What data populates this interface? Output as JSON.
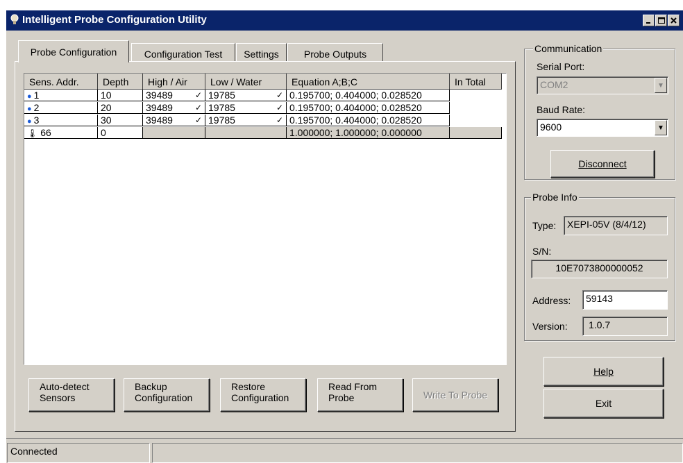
{
  "window": {
    "title": "Intelligent Probe Configuration Utility",
    "controls": [
      "minimize-icon",
      "maximize-icon",
      "close-icon"
    ]
  },
  "tabs": [
    {
      "label": "Probe Configuration",
      "active": true
    },
    {
      "label": "Configuration Test",
      "active": false
    },
    {
      "label": "Settings",
      "active": false
    },
    {
      "label": "Probe Outputs",
      "active": false
    }
  ],
  "grid": {
    "columns": [
      "Sens. Addr.",
      "Depth",
      "High / Air",
      "Low / Water",
      "Equation  A;B;C",
      "In Total"
    ],
    "rows": [
      {
        "icon": "water-drop-icon",
        "addr": "1",
        "depth": "10",
        "high": "39489",
        "low": "19785",
        "equation": "0.195700; 0.404000; 0.028520",
        "total": ""
      },
      {
        "icon": "water-drop-icon",
        "addr": "2",
        "depth": "20",
        "high": "39489",
        "low": "19785",
        "equation": "0.195700; 0.404000; 0.028520",
        "total": ""
      },
      {
        "icon": "water-drop-icon",
        "addr": "3",
        "depth": "30",
        "high": "39489",
        "low": "19785",
        "equation": "0.195700; 0.404000; 0.028520",
        "total": ""
      },
      {
        "icon": "thermometer-icon",
        "addr": "66",
        "depth": "0",
        "high": "",
        "low": "",
        "equation": "1.000000; 1.000000; 0.000000",
        "total": ""
      }
    ]
  },
  "actions": {
    "auto_detect": "Auto-detect\nSensors",
    "backup": "Backup\nConfiguration",
    "restore": "Restore\nConfiguration",
    "read": "Read From\nProbe",
    "write": "Write To Probe"
  },
  "communication": {
    "group_label": "Communication",
    "serial_port_label": "Serial Port:",
    "serial_port_value": "COM2",
    "baud_rate_label": "Baud Rate:",
    "baud_rate_value": "9600",
    "disconnect_label": "Disconnect"
  },
  "probe_info": {
    "group_label": "Probe Info",
    "type_label": "Type:",
    "type_value": "XEPI-05V (8/4/12)",
    "sn_label": "S/N:",
    "sn_value": "10E7073800000052",
    "address_label": "Address:",
    "address_value": "59143",
    "version_label": "Version:",
    "version_value": "1.0.7"
  },
  "buttons": {
    "help": "Help",
    "exit": "Exit"
  },
  "status": {
    "text": "Connected",
    "secondary": ""
  },
  "colors": {
    "titlebar": "#0a246a",
    "face": "#d4d0c8",
    "drop": "#1a5ad8"
  }
}
